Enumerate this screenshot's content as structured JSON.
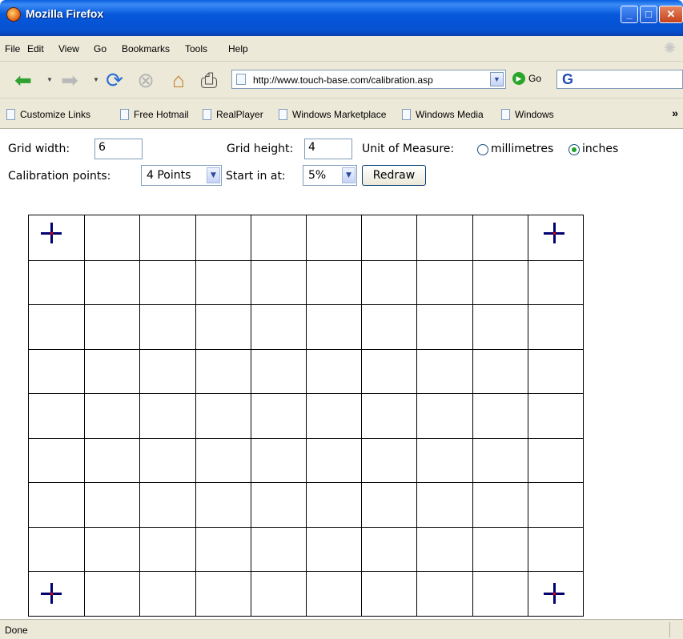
{
  "window": {
    "title": "Mozilla Firefox",
    "controls": [
      "minimize",
      "maximize",
      "close"
    ]
  },
  "menu": {
    "items": [
      "File",
      "Edit",
      "View",
      "Go",
      "Bookmarks",
      "Tools",
      "Help"
    ]
  },
  "navigation": {
    "url": "http://www.touch-base.com/calibration.asp",
    "go_label": "Go",
    "search_engine_icon": "google-icon",
    "icons": [
      "back-icon",
      "forward-icon",
      "reload-icon",
      "stop-icon",
      "home-icon",
      "print-icon"
    ]
  },
  "bookmarks": {
    "links": [
      "Customize Links",
      "Free Hotmail",
      "RealPlayer",
      "Windows Marketplace",
      "Windows Media",
      "Windows"
    ],
    "overflow": "»"
  },
  "form": {
    "grid_width_label": "Grid width:",
    "grid_width_value": "6",
    "grid_height_label": "Grid height:",
    "grid_height_value": "4",
    "unit_label": "Unit of Measure:",
    "unit_options": [
      "millimetres",
      "inches"
    ],
    "unit_selected": "inches",
    "calibration_points_label": "Calibration points:",
    "calibration_points_value": "4 Points",
    "start_in_label": "Start in at:",
    "start_in_value": "5%",
    "redraw_label": "Redraw"
  },
  "calibration_grid": {
    "columns": 10,
    "rows": 9,
    "crosshairs": [
      "top-left",
      "top-right",
      "bottom-left",
      "bottom-right"
    ],
    "crosshair_color": "#000070",
    "center_dot_color": "#e00000"
  },
  "status": {
    "text": "Done"
  }
}
